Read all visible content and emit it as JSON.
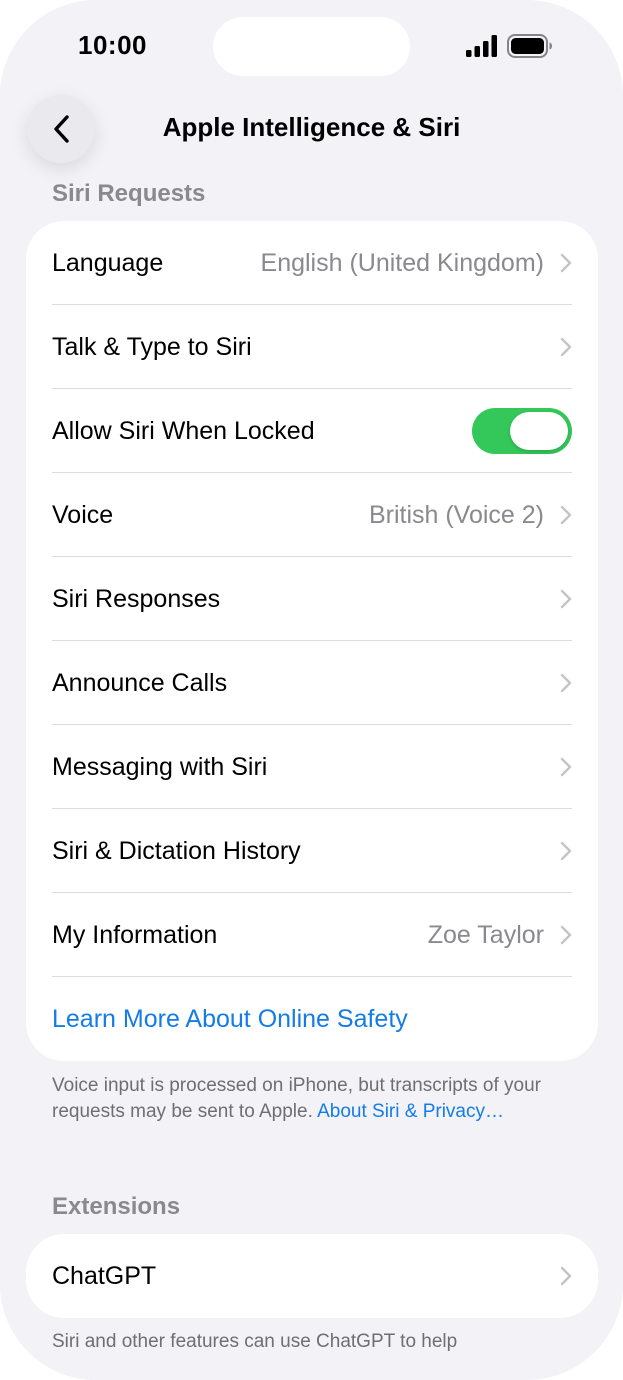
{
  "status_bar": {
    "time": "10:00",
    "signal_icon": "cellular-signal-icon",
    "battery_icon": "battery-icon"
  },
  "nav": {
    "back_icon": "chevron-left-icon",
    "title": "Apple Intelligence & Siri"
  },
  "siri_requests": {
    "header": "Siri Requests",
    "rows": [
      {
        "label": "Language",
        "value": "English (United Kingdom)",
        "accessory": "chevron"
      },
      {
        "label": "Talk & Type to Siri",
        "value": "",
        "accessory": "chevron"
      },
      {
        "label": "Allow Siri When Locked",
        "value": "",
        "accessory": "toggle",
        "toggle_on": true
      },
      {
        "label": "Voice",
        "value": "British (Voice 2)",
        "accessory": "chevron"
      },
      {
        "label": "Siri Responses",
        "value": "",
        "accessory": "chevron"
      },
      {
        "label": "Announce Calls",
        "value": "",
        "accessory": "chevron"
      },
      {
        "label": "Messaging with Siri",
        "value": "",
        "accessory": "chevron"
      },
      {
        "label": "Siri & Dictation History",
        "value": "",
        "accessory": "chevron"
      },
      {
        "label": "My Information",
        "value": "Zoe Taylor",
        "accessory": "chevron"
      }
    ],
    "link": "Learn More About Online Safety",
    "footer_text": "Voice input is processed on iPhone, but transcripts of your requests may be sent to Apple. ",
    "footer_link": "About Siri & Privacy…"
  },
  "extensions": {
    "header": "Extensions",
    "rows": [
      {
        "label": "ChatGPT",
        "accessory": "chevron"
      }
    ],
    "footer_text": "Siri and other features can use ChatGPT to help"
  },
  "colors": {
    "background": "#f2f2f7",
    "toggle_on": "#34c759",
    "link": "#147ce5",
    "secondary_text": "#8a8a8e"
  }
}
